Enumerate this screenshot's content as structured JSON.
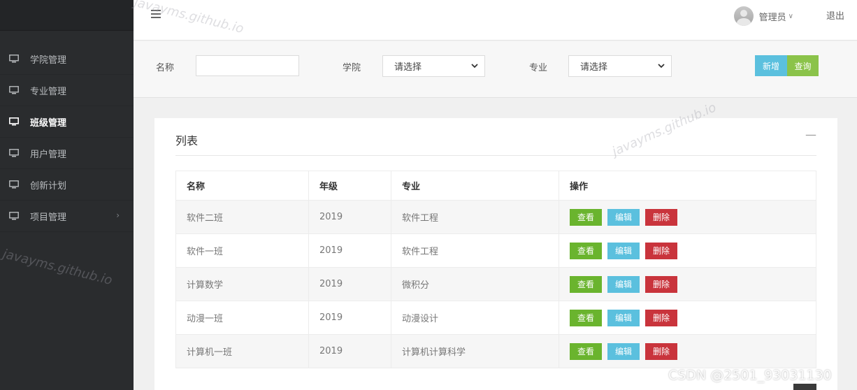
{
  "sidebar": {
    "items": [
      {
        "label": "学院管理"
      },
      {
        "label": "专业管理"
      },
      {
        "label": "班级管理"
      },
      {
        "label": "用户管理"
      },
      {
        "label": "创新计划"
      },
      {
        "label": "项目管理",
        "arrow": "›"
      }
    ]
  },
  "topbar": {
    "user_name": "管理员",
    "user_caret": "∨",
    "logout_label": "退出"
  },
  "filter": {
    "name_label": "名称",
    "name_value": "",
    "college_label": "学院",
    "college_selected": "请选择",
    "major_label": "专业",
    "major_selected": "请选择",
    "new_button": "新增",
    "query_button": "查询"
  },
  "panel": {
    "title": "列表",
    "collapse_symbol": "—",
    "table": {
      "headers": [
        "名称",
        "年级",
        "专业",
        "操作"
      ],
      "rows": [
        {
          "name": "软件二班",
          "grade": "2019",
          "major": "软件工程"
        },
        {
          "name": "软件一班",
          "grade": "2019",
          "major": "软件工程"
        },
        {
          "name": "计算数学",
          "grade": "2019",
          "major": "微积分"
        },
        {
          "name": "动漫一班",
          "grade": "2019",
          "major": "动漫设计"
        },
        {
          "name": "计算机一班",
          "grade": "2019",
          "major": "计算机计算科学"
        }
      ],
      "actions": {
        "view": "查看",
        "edit": "编辑",
        "delete": "删除"
      }
    }
  },
  "watermarks": {
    "site": "javayms.github.io",
    "csdn": "CSDN @2501_93031130"
  },
  "colors": {
    "sidebar_bg": "#2a2c2e",
    "view_button": "#6ab42e",
    "edit_button": "#5bc0de",
    "delete_button": "#c9343c",
    "query_button": "#8bc34a"
  }
}
